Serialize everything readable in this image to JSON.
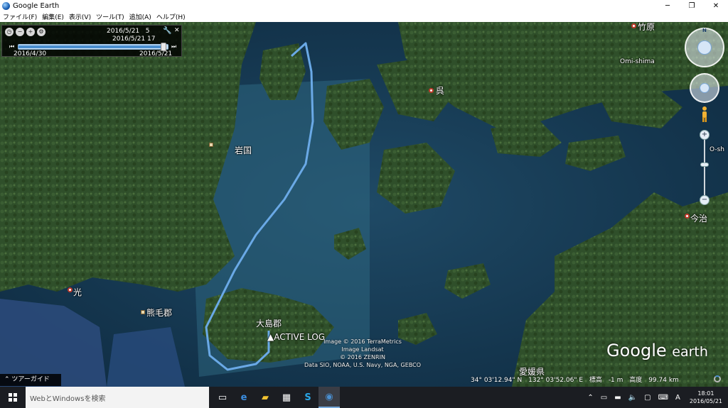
{
  "window": {
    "title": "Google Earth",
    "buttons": {
      "minimize": "─",
      "maximize": "❐",
      "close": "✕"
    }
  },
  "menu": [
    "ファイル(F)",
    "編集(E)",
    "表示(V)",
    "ツール(T)",
    "追加(A)",
    "ヘルプ(H)"
  ],
  "time_slider": {
    "current_date": "2016/5/21",
    "current_hour": "5",
    "end_time": "2016/5/21 17",
    "range_start": "2016/4/30",
    "range_end": "2016/5/21",
    "tools": [
      "clock-icon",
      "zoom-out-icon",
      "zoom-in-icon",
      "settings-icon"
    ],
    "position": 0.97
  },
  "places": {
    "iwakuni": "岩国",
    "kure": "呉",
    "imabari": "今治",
    "hikari": "光",
    "kumage": "熊毛郡",
    "oshima": "大島郡",
    "takehara": "竹原",
    "omishima": "Omi-shima",
    "oshi": "O-sh",
    "ehime": "愛媛県",
    "track": "ACTIVE LOG"
  },
  "credits": [
    "Image © 2016 TerraMetrics",
    "Image Landsat",
    "© 2016 ZENRIN",
    "Data SIO, NOAA, U.S. Navy, NGA, GEBCO"
  ],
  "logo": {
    "google": "Google",
    "earth": "earth"
  },
  "tour_guide": "ツアーガイド",
  "status": {
    "lat": "34° 03'12.94\" N",
    "lon": "132° 03'52.06\" E",
    "elev_label": "標高",
    "elev_value": "-1 m",
    "alt_label": "高度",
    "alt_value": "99.74 km"
  },
  "taskbar": {
    "search_placeholder": "WebとWindowsを検索",
    "time": "18:01",
    "date": "2016/05/21",
    "ime": "A"
  },
  "colors": {
    "track": "#6aa9e6",
    "accent": "#78aadc"
  }
}
